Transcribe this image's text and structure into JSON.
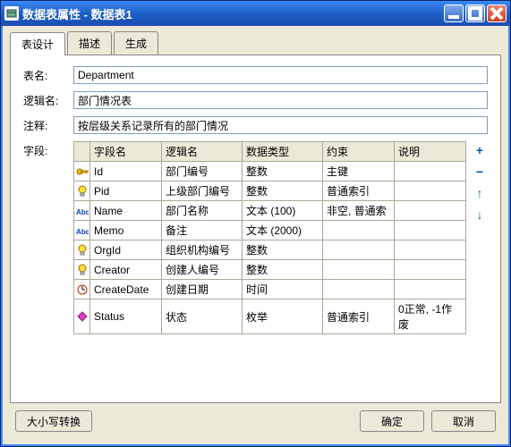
{
  "window": {
    "title": "数据表属性 - 数据表1"
  },
  "tabs": {
    "design": "表设计",
    "desc": "描述",
    "gen": "生成"
  },
  "labels": {
    "tableName": "表名:",
    "logicName": "逻辑名:",
    "comment": "注释:",
    "fields": "字段:"
  },
  "values": {
    "tableName": "Department",
    "logicName": "部门情况表",
    "comment": "按层级关系记录所有的部门情况"
  },
  "columns": {
    "name": "字段名",
    "logic": "逻辑名",
    "dtype": "数据类型",
    "constraint": "约束",
    "desc": "说明"
  },
  "rows": [
    {
      "icon": "key",
      "name": "Id",
      "logic": "部门编号",
      "dtype": "整数",
      "constraint": "主键",
      "desc": ""
    },
    {
      "icon": "bulb",
      "name": "Pid",
      "logic": "上级部门编号",
      "dtype": "整数",
      "constraint": "普通索引",
      "desc": ""
    },
    {
      "icon": "abc",
      "name": "Name",
      "logic": "部门名称",
      "dtype": "文本 (100)",
      "constraint": "非空, 普通索",
      "desc": ""
    },
    {
      "icon": "abc",
      "name": "Memo",
      "logic": "备注",
      "dtype": "文本 (2000)",
      "constraint": "",
      "desc": ""
    },
    {
      "icon": "bulb",
      "name": "OrgId",
      "logic": "组织机构编号",
      "dtype": "整数",
      "constraint": "",
      "desc": ""
    },
    {
      "icon": "bulb",
      "name": "Creator",
      "logic": "创建人编号",
      "dtype": "整数",
      "constraint": "",
      "desc": ""
    },
    {
      "icon": "clock",
      "name": "CreateDate",
      "logic": "创建日期",
      "dtype": "时间",
      "constraint": "",
      "desc": ""
    },
    {
      "icon": "diamond",
      "name": "Status",
      "logic": "状态",
      "dtype": "枚举",
      "constraint": "普通索引",
      "desc": "0正常, -1作废"
    }
  ],
  "side": {
    "add": "+",
    "remove": "−",
    "up": "↑",
    "down": "↓"
  },
  "footer": {
    "caseToggle": "大小写转换",
    "ok": "确定",
    "cancel": "取消"
  }
}
